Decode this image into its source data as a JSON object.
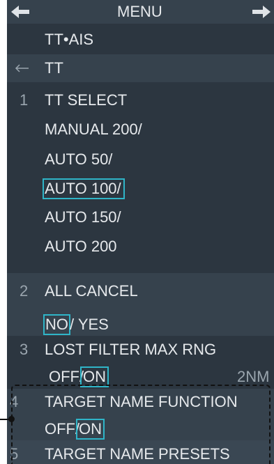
{
  "header": {
    "title": "MENU",
    "left_arrow_icon": "arrow-left-icon",
    "right_arrow_icon": "arrow-right-icon"
  },
  "submenu": "TT•AIS",
  "section": {
    "back_icon": "back-arrow-icon",
    "label": "TT"
  },
  "items": [
    {
      "number": "1",
      "label": "TT SELECT",
      "options": [
        "MANUAL 200/",
        "AUTO 50/",
        "AUTO 100/",
        "AUTO 150/",
        "AUTO 200"
      ],
      "selected": "AUTO 100/"
    },
    {
      "number": "2",
      "label": "ALL CANCEL",
      "options": [
        "NO",
        "/ YES"
      ],
      "selected": "NO"
    },
    {
      "number": "3",
      "label": "LOST FILTER MAX RNG",
      "options": [
        "OFF/",
        "ON"
      ],
      "selected": "ON",
      "value": "2NM"
    },
    {
      "number": "4",
      "label": "TARGET NAME FUNCTION",
      "options": [
        "OFF/",
        "ON"
      ],
      "selected": "ON"
    },
    {
      "number": "5",
      "label": "TARGET NAME PRESETS"
    }
  ],
  "colors": {
    "background": "#2c3640",
    "band": "#36424d",
    "text": "#e6e9ec",
    "selection_border": "#2fb5c8"
  }
}
